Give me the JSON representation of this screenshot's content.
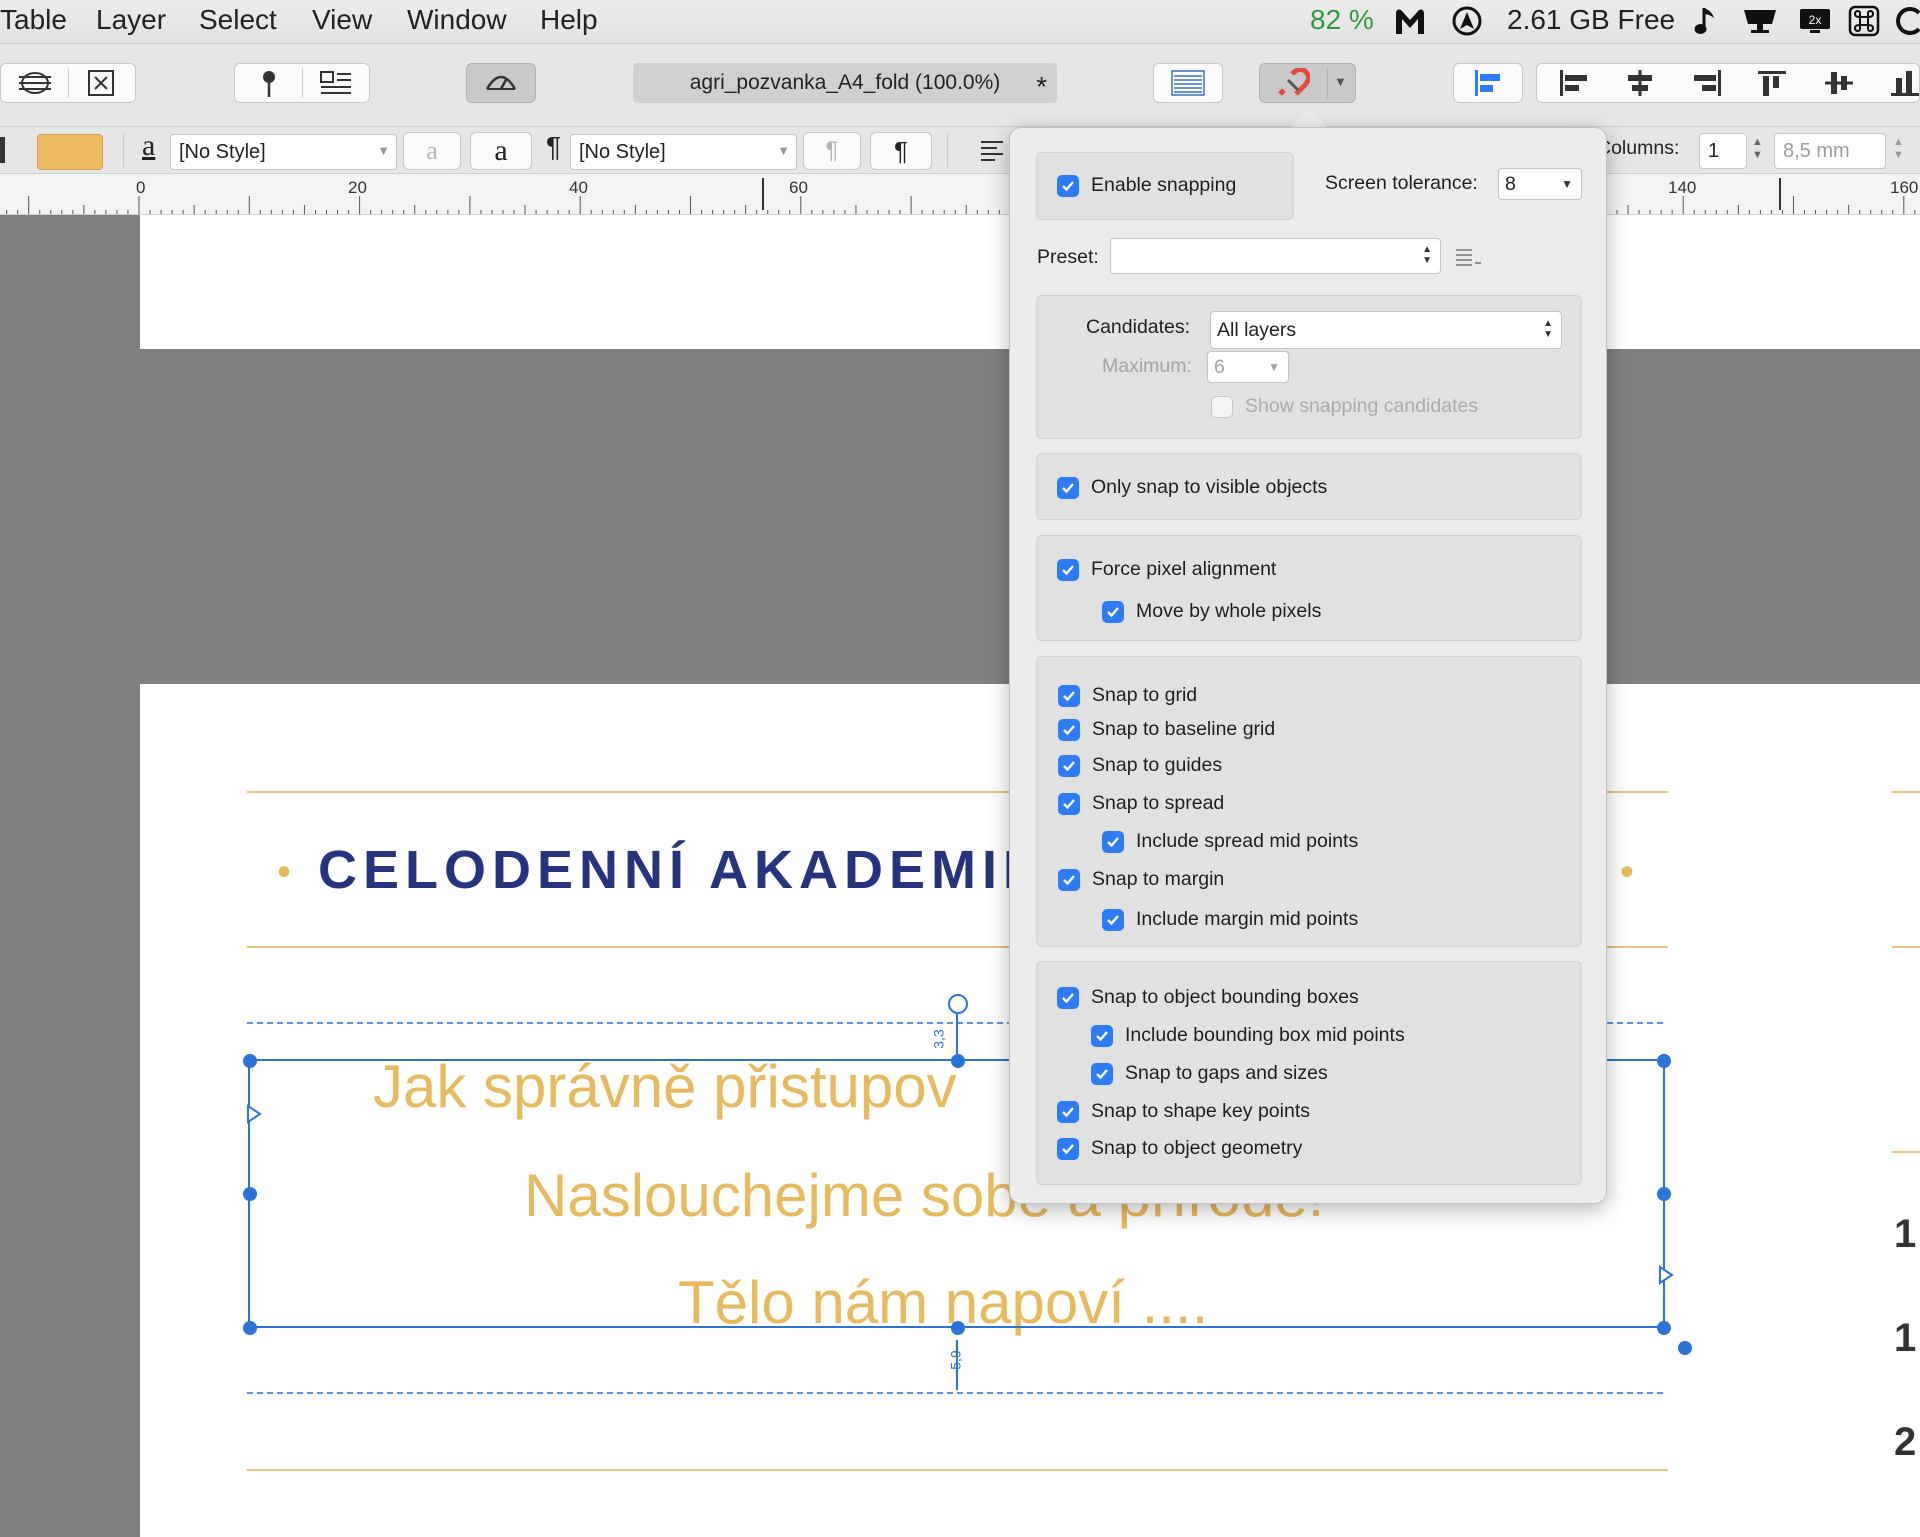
{
  "menu": [
    "Table",
    "Layer",
    "Select",
    "View",
    "Window",
    "Help"
  ],
  "tray": {
    "battery": "82 %",
    "disk": "2.61 GB Free",
    "colors": {
      "battery": "#2e9c3a"
    }
  },
  "toolbar": {
    "document_tab": "agri_pozvanka_A4_fold (100.0%)",
    "modified_mark": "*"
  },
  "context": {
    "char_style_glyph": "a",
    "char_style": "[No Style]",
    "para_style_glyph": "¶",
    "para_style": "[No Style]",
    "columns_label": "Columns:",
    "columns_value": "1",
    "gutter_value": "8,5 mm",
    "fill_color": "#efbd5f"
  },
  "ruler": {
    "labels": [
      "0",
      "20",
      "40",
      "60",
      "140",
      "160"
    ]
  },
  "document": {
    "heading": "CELODENNÍ AKADEMIE",
    "bullet": "•",
    "line1": "Jak správně přistupov",
    "line2": "Naslouchejme sobě a přírodě!",
    "line3": "Tělo nám napoví ....",
    "top_margin_readout": "3,3",
    "bottom_margin_readout": "5,9",
    "side_digits": [
      "1",
      "1",
      "2"
    ],
    "colors": {
      "heading": "#26347f",
      "accent": "#e9b95e",
      "selection": "#2a74d5"
    }
  },
  "snapping": {
    "enable": {
      "label": "Enable snapping",
      "checked": true
    },
    "tolerance_label": "Screen tolerance:",
    "tolerance_value": "8",
    "preset_label": "Preset:",
    "preset_value": "",
    "candidates_label": "Candidates:",
    "candidates_value": "All layers",
    "maximum_label": "Maximum:",
    "maximum_value": "6",
    "show_candidates": {
      "label": "Show snapping candidates",
      "checked": false
    },
    "only_visible": {
      "label": "Only snap to visible objects",
      "checked": true
    },
    "force_pixel": {
      "label": "Force pixel alignment",
      "checked": true
    },
    "move_whole": {
      "label": "Move by whole pixels",
      "checked": true
    },
    "grid": {
      "label": "Snap to grid",
      "checked": true
    },
    "baseline": {
      "label": "Snap to baseline grid",
      "checked": true
    },
    "guides": {
      "label": "Snap to guides",
      "checked": true
    },
    "spread": {
      "label": "Snap to spread",
      "checked": true
    },
    "spread_mid": {
      "label": "Include spread mid points",
      "checked": true
    },
    "margin": {
      "label": "Snap to margin",
      "checked": true
    },
    "margin_mid": {
      "label": "Include margin mid points",
      "checked": true
    },
    "bbox": {
      "label": "Snap to object bounding boxes",
      "checked": true
    },
    "bbox_mid": {
      "label": "Include bounding box mid points",
      "checked": true
    },
    "gaps": {
      "label": "Snap to gaps and sizes",
      "checked": true
    },
    "shape_key": {
      "label": "Snap to shape key points",
      "checked": true
    },
    "geometry": {
      "label": "Snap to object geometry",
      "checked": true
    }
  }
}
